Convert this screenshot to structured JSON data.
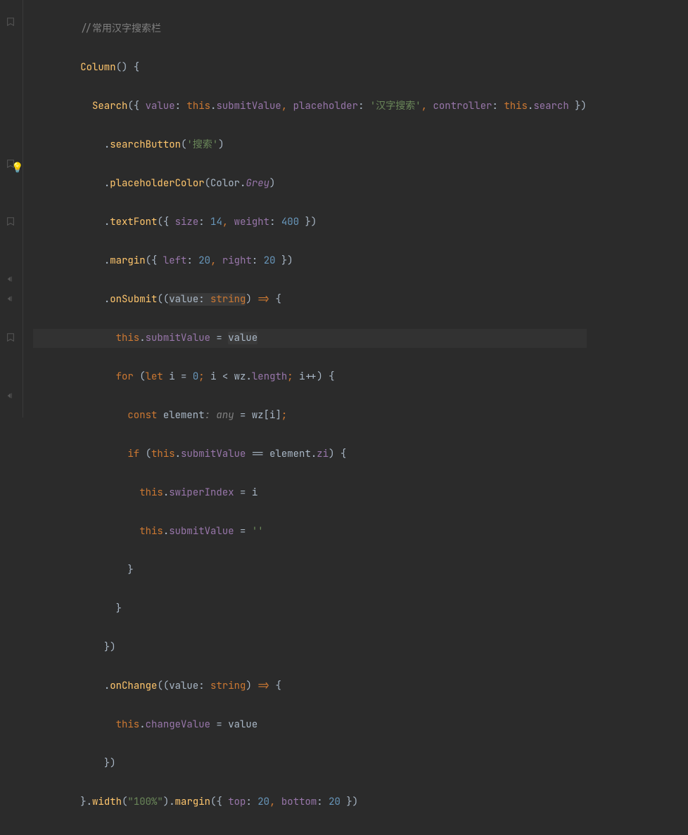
{
  "code": {
    "l1_comment": "//常用汉字搜索栏",
    "l2_column": "Column",
    "l2_paren": "() {",
    "l3_search": "Search",
    "l3_value_k": "value",
    "l3_this1": "this",
    "l3_submitValue": "submitValue",
    "l3_placeholder_k": "placeholder",
    "l3_placeholder_s": "'汉字搜索'",
    "l3_controller_k": "controller",
    "l3_this2": "this",
    "l3_search_prop": "search",
    "l4_searchButton": "searchButton",
    "l4_arg": "'搜索'",
    "l5_placeholderColor": "placeholderColor",
    "l5_color": "Color",
    "l5_grey": "Grey",
    "l6_textFont": "textFont",
    "l6_size_k": "size",
    "l6_size_v": "14",
    "l6_weight_k": "weight",
    "l6_weight_v": "400",
    "l7_margin": "margin",
    "l7_left_k": "left",
    "l7_left_v": "20",
    "l7_right_k": "right",
    "l7_right_v": "20",
    "l8_onSubmit": "onSubmit",
    "l8_value": "value",
    "l8_string_t": "string",
    "l9_this": "this",
    "l9_submitValue": "submitValue",
    "l9_value": "value",
    "l10_for": "for",
    "l10_let": "let",
    "l10_i": "i",
    "l10_zero": "0",
    "l10_i2": "i",
    "l10_wz": "wz",
    "l10_length": "length",
    "l10_i3": "i",
    "l11_const": "const",
    "l11_element": "element",
    "l11_any_ann": ": any",
    "l11_wz": "wz",
    "l11_i": "i",
    "l12_if": "if",
    "l12_this": "this",
    "l12_submitValue": "submitValue",
    "l12_element": "element",
    "l12_zi": "zi",
    "l13_this": "this",
    "l13_swiperIndex": "swiperIndex",
    "l13_i": "i",
    "l14_this": "this",
    "l14_submitValue": "submitValue",
    "l14_empty": "''",
    "l18_onChange": "onChange",
    "l18_value": "value",
    "l18_string_t": "string",
    "l19_this": "this",
    "l19_changeValue": "changeValue",
    "l19_value": "value",
    "l21_width": "width",
    "l21_width_v": "\"100%\"",
    "l21_margin": "margin",
    "l21_top_k": "top",
    "l21_top_v": "20",
    "l21_bottom_k": "bottom",
    "l21_bottom_v": "20"
  }
}
